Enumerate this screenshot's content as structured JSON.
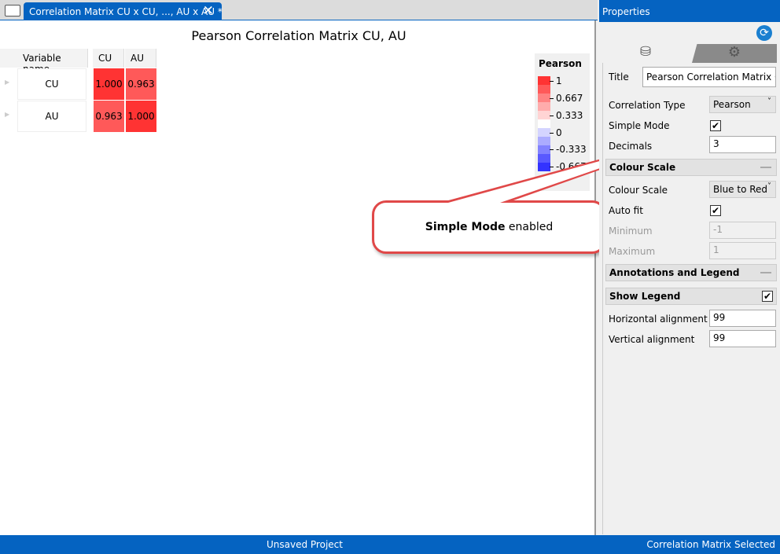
{
  "tab": {
    "title": "Correlation Matrix CU x CU, ..., AU x AU *"
  },
  "chart_data": {
    "type": "heatmap",
    "title": "Pearson Correlation Matrix CU, AU",
    "row_header": "Variable name",
    "columns": [
      "CU",
      "AU"
    ],
    "rows": [
      {
        "name": "CU",
        "values": [
          "1.000",
          "0.963"
        ]
      },
      {
        "name": "AU",
        "values": [
          "0.963",
          "1.000"
        ]
      }
    ],
    "legend": {
      "title": "Pearson",
      "ticks": [
        "1",
        "0.667",
        "0.333",
        "0",
        "-0.333",
        "-0.667"
      ],
      "colors": [
        "#ff3333",
        "#ff5959",
        "#ff8282",
        "#ffacac",
        "#ffd4d4",
        "#ffffff",
        "#d4d4ff",
        "#acacff",
        "#8282ff",
        "#5959ff",
        "#3333ff"
      ]
    },
    "cell_colors": [
      [
        "#ff3333",
        "#ff5959"
      ],
      [
        "#ff5959",
        "#ff3333"
      ]
    ]
  },
  "properties": {
    "header": "Properties",
    "title_label": "Title",
    "title_value": "Pearson Correlation Matrix CU,",
    "correlation_type_label": "Correlation Type",
    "correlation_type": "Pearson",
    "simple_mode_label": "Simple Mode",
    "simple_mode": true,
    "decimals_label": "Decimals",
    "decimals": "3",
    "colour_scale_section": "Colour Scale",
    "colour_scale_label": "Colour Scale",
    "colour_scale": "Blue to Red",
    "auto_fit_label": "Auto fit",
    "auto_fit": true,
    "minimum_label": "Minimum",
    "minimum": "-1",
    "maximum_label": "Maximum",
    "maximum": "1",
    "annotations_section": "Annotations and Legend",
    "show_legend_label": "Show Legend",
    "show_legend": true,
    "h_align_label": "Horizontal alignment",
    "h_align": "99",
    "v_align_label": "Vertical alignment",
    "v_align": "99"
  },
  "callout": {
    "bold": "Simple Mode",
    "rest": " enabled"
  },
  "status": {
    "center": "Unsaved Project",
    "right": "Correlation Matrix Selected"
  }
}
